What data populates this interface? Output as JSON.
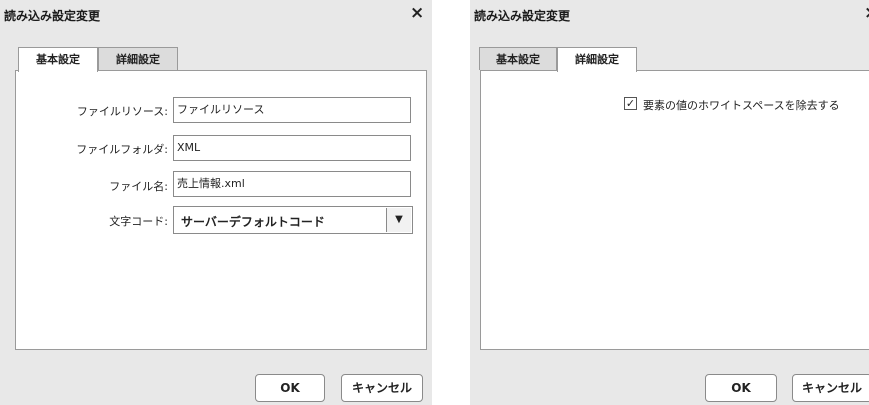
{
  "dialog_left": {
    "title": "読み込み設定変更",
    "close_glyph": "×",
    "tabs": [
      {
        "label": "基本設定",
        "active": true
      },
      {
        "label": "詳細設定",
        "active": false
      }
    ],
    "fields": {
      "file_resource_label": "ファイルリソース:",
      "file_resource_value": "ファイルリソース",
      "file_folder_label": "ファイルフォルダ:",
      "file_folder_value": "XML",
      "file_name_label": "ファイル名:",
      "file_name_value": "売上情報.xml",
      "charset_label": "文字コード:",
      "charset_value": "サーバーデフォルトコード"
    },
    "buttons": {
      "ok": "OK",
      "cancel": "キャンセル"
    }
  },
  "dialog_right": {
    "title": "読み込み設定変更",
    "close_glyph": "×",
    "tabs": [
      {
        "label": "基本設定",
        "active": false
      },
      {
        "label": "詳細設定",
        "active": true
      }
    ],
    "checkbox": {
      "label": "要素の値のホワイトスペースを除去する",
      "checked": true,
      "mark": "✓"
    },
    "buttons": {
      "ok": "OK",
      "cancel": "キャンセル"
    }
  },
  "icons": {
    "dropdown": "chevron-down-icon",
    "close": "close-icon",
    "check": "check-icon"
  }
}
